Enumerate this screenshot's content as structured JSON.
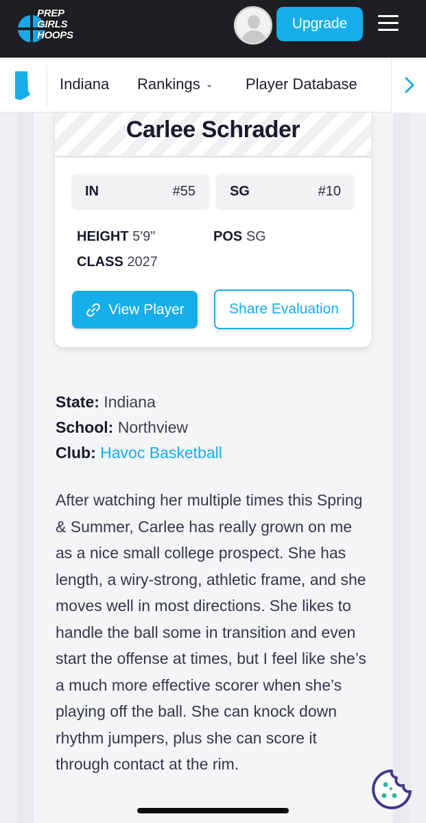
{
  "header": {
    "logo_lines": [
      "PREP",
      "GIRLS",
      "HOOPS"
    ],
    "upgrade_label": "Upgrade"
  },
  "nav": {
    "state": "Indiana",
    "rankings": "Rankings",
    "player_database": "Player Database",
    "chevron": "⌄"
  },
  "player": {
    "name": "Carlee Schrader",
    "state_code": "IN",
    "state_rank": "#55",
    "position_code": "SG",
    "position_rank": "#10",
    "height_label": "HEIGHT",
    "height": "5'9\"",
    "class_label": "CLASS",
    "class": "2027",
    "pos_label": "POS",
    "pos": "SG",
    "view_player_label": "View Player",
    "share_label": "Share Evaluation"
  },
  "info": {
    "state_label": "State:",
    "state": "Indiana",
    "school_label": "School:",
    "school": "Northview",
    "club_label": "Club:",
    "club": "Havoc Basketball"
  },
  "bio": "After watching her multiple times this Spring & Summer, Carlee has really grown on me as a nice small college prospect. She has length, a wiry-strong, athletic frame, and she moves well in most directions. She likes to handle the ball some in transition and even start the offense at times, but I feel like she’s a much more effective scorer when she’s playing off the ball. She can knock down rhythm jumpers, plus she can score it through contact at the rim.",
  "colors": {
    "accent": "#16aee8",
    "topbar": "#1e1f22",
    "cookie": "#3f3a8c"
  }
}
